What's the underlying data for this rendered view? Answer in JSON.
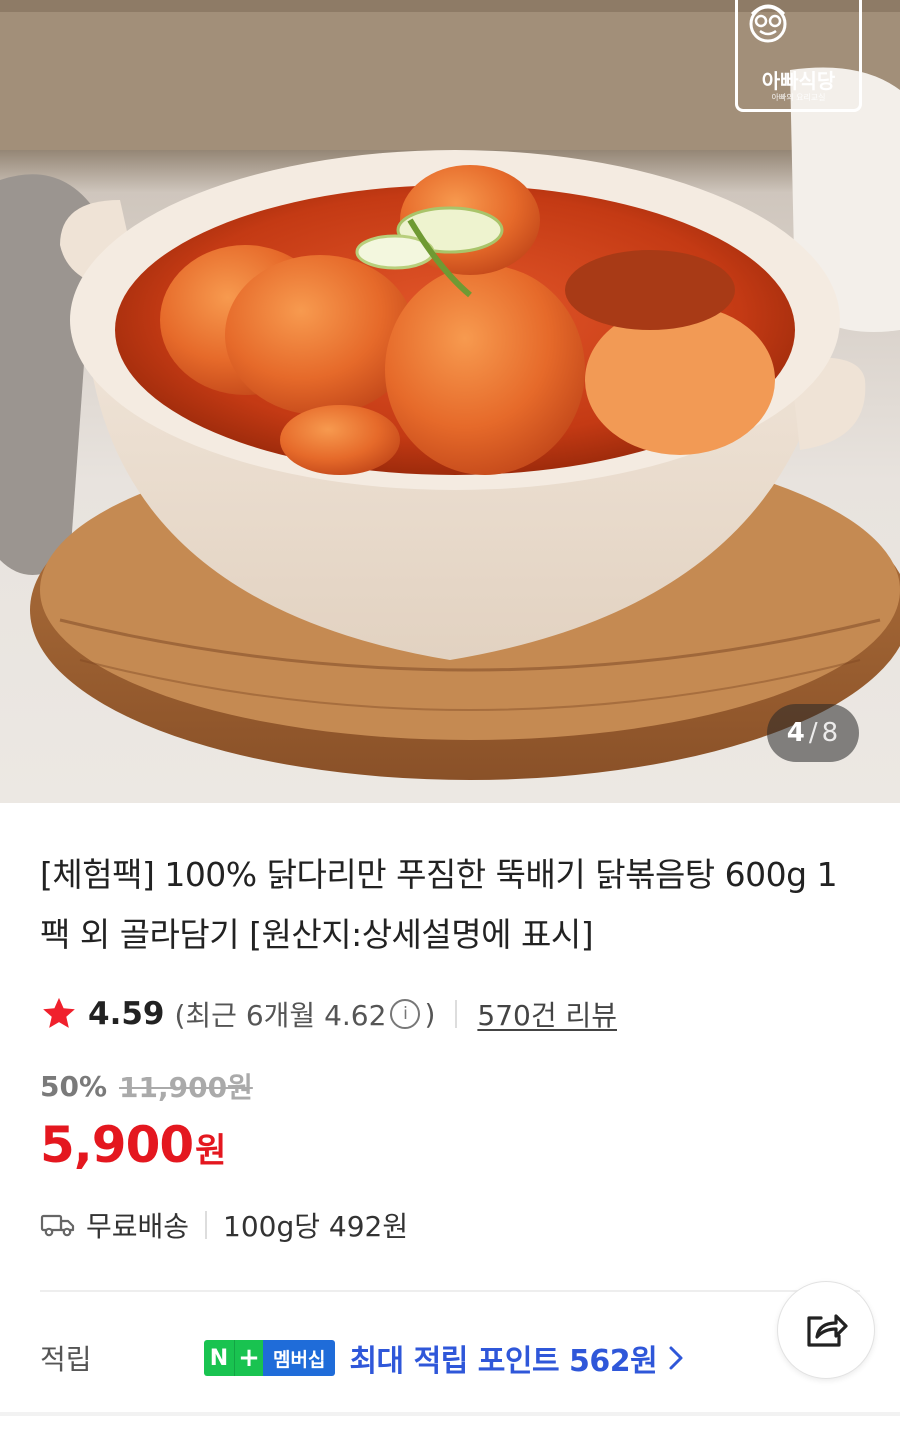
{
  "hero": {
    "brand_logo_text": "아빠식당",
    "brand_logo_sub": "아빠의 요리교실",
    "page_current": "4",
    "page_separator": "/",
    "page_total": "8"
  },
  "product": {
    "title": "[체험팩] 100% 닭다리만 푸짐한 뚝배기 닭볶음탕 600g 1팩 외 골라담기 [원산지:상세설명에 표시]",
    "rating": "4.59",
    "rating_recent_prefix": "(최근 6개월 4.62",
    "rating_recent_suffix": ")",
    "info_icon": "i",
    "review_count": "570건 리뷰",
    "discount_rate": "50%",
    "original_price": "11,900원",
    "price": "5,900",
    "price_unit": "원",
    "shipping": "무료배송",
    "unit_price": "100g당 492원"
  },
  "points": {
    "label": "적립",
    "badge_n": "N",
    "badge_plus": "+",
    "badge_membership": "멤버십",
    "text": "최대 적립 포인트 562원"
  },
  "icons": {
    "star": "star-icon",
    "truck": "truck-icon",
    "share": "share-icon",
    "chevron": "chevron-right-icon",
    "info": "info-icon"
  },
  "colors": {
    "price_red": "#e4171f",
    "points_blue": "#2f57d9",
    "npay_green": "#19c350",
    "membership_blue": "#1f6cd9"
  }
}
